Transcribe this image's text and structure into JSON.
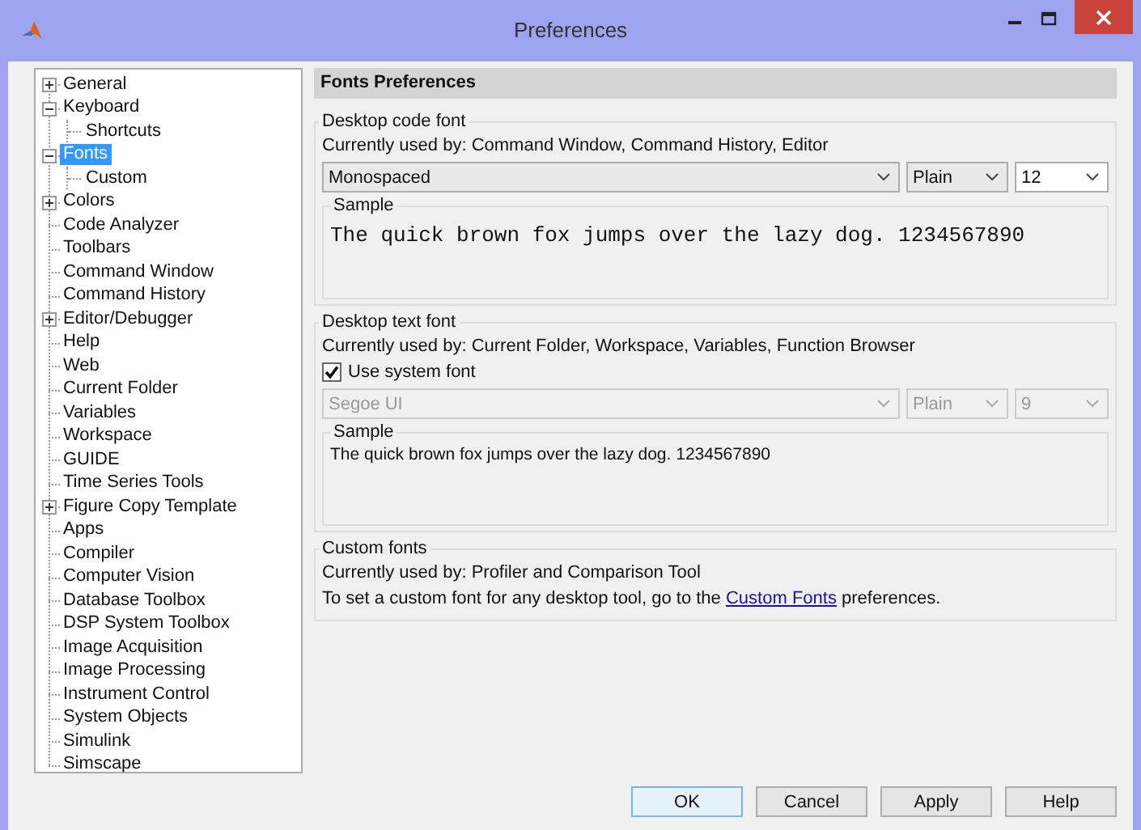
{
  "window": {
    "title": "Preferences"
  },
  "tree": [
    {
      "label": "General",
      "kind": "folder",
      "expanded": false,
      "selected": false
    },
    {
      "label": "Keyboard",
      "kind": "folder",
      "expanded": true,
      "selected": false,
      "children": [
        {
          "label": "Shortcuts",
          "selected": false
        }
      ]
    },
    {
      "label": "Fonts",
      "kind": "folder",
      "expanded": true,
      "selected": true,
      "children": [
        {
          "label": "Custom",
          "selected": false
        }
      ]
    },
    {
      "label": "Colors",
      "kind": "folder",
      "expanded": false,
      "selected": false
    },
    {
      "label": "Code Analyzer",
      "kind": "leaf",
      "selected": false
    },
    {
      "label": "Toolbars",
      "kind": "leaf",
      "selected": false
    },
    {
      "label": "Command Window",
      "kind": "leaf",
      "selected": false
    },
    {
      "label": "Command History",
      "kind": "leaf",
      "selected": false
    },
    {
      "label": "Editor/Debugger",
      "kind": "folder",
      "expanded": false,
      "selected": false
    },
    {
      "label": "Help",
      "kind": "leaf",
      "selected": false
    },
    {
      "label": "Web",
      "kind": "leaf",
      "selected": false
    },
    {
      "label": "Current Folder",
      "kind": "leaf",
      "selected": false
    },
    {
      "label": "Variables",
      "kind": "leaf",
      "selected": false
    },
    {
      "label": "Workspace",
      "kind": "leaf",
      "selected": false
    },
    {
      "label": "GUIDE",
      "kind": "leaf",
      "selected": false
    },
    {
      "label": "Time Series Tools",
      "kind": "leaf",
      "selected": false
    },
    {
      "label": "Figure Copy Template",
      "kind": "folder",
      "expanded": false,
      "selected": false
    },
    {
      "label": "Apps",
      "kind": "leaf",
      "selected": false
    },
    {
      "label": "Compiler",
      "kind": "leaf",
      "selected": false
    },
    {
      "label": "Computer Vision",
      "kind": "leaf",
      "selected": false
    },
    {
      "label": "Database Toolbox",
      "kind": "leaf",
      "selected": false
    },
    {
      "label": "DSP System Toolbox",
      "kind": "leaf",
      "selected": false
    },
    {
      "label": "Image Acquisition",
      "kind": "leaf",
      "selected": false
    },
    {
      "label": "Image Processing",
      "kind": "leaf",
      "selected": false
    },
    {
      "label": "Instrument Control",
      "kind": "leaf",
      "selected": false
    },
    {
      "label": "System Objects",
      "kind": "leaf",
      "selected": false
    },
    {
      "label": "Simulink",
      "kind": "leaf",
      "selected": false
    },
    {
      "label": "Simscape",
      "kind": "leaf",
      "selected": false
    }
  ],
  "panel": {
    "title": "Fonts Preferences",
    "groups": [
      {
        "kind": "code",
        "title": "Desktop code font",
        "used_by": "Currently used by: Command Window, Command History, Editor",
        "font": "Monospaced",
        "style": "Plain",
        "size": "12",
        "disabled": false,
        "sample_label": "Sample",
        "sample": "The quick brown fox jumps over the lazy dog.  1234567890"
      },
      {
        "kind": "text",
        "title": "Desktop text font",
        "used_by": "Currently used by: Current Folder, Workspace, Variables, Function Browser",
        "checkbox": {
          "label": "Use system font",
          "checked": true
        },
        "font": "Segoe UI",
        "style": "Plain",
        "size": "9",
        "disabled": true,
        "sample_label": "Sample",
        "sample": "The quick brown fox jumps over the lazy dog.  1234567890"
      }
    ],
    "custom": {
      "title": "Custom fonts",
      "used_by": "Currently used by: Profiler and Comparison Tool",
      "note_before": "To set a custom font for any desktop tool, go to the",
      "link": "Custom Fonts",
      "note_after": "preferences."
    }
  },
  "buttons": [
    {
      "label": "OK",
      "default": true
    },
    {
      "label": "Cancel",
      "default": false
    },
    {
      "label": "Apply",
      "default": false
    },
    {
      "label": "Help",
      "default": false
    }
  ]
}
